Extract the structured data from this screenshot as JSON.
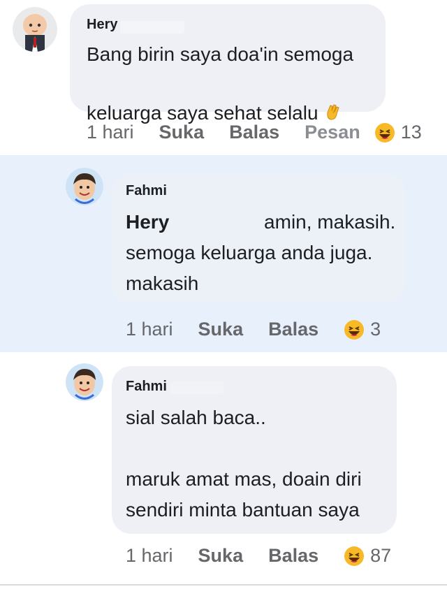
{
  "comments": [
    {
      "author": "Hery",
      "text": "Bang birin saya doa'in semoga\nkeluarga saya sehat selalu",
      "emoji_icon": "clapping-hands-icon",
      "time": "1 hari",
      "like": "Suka",
      "reply": "Balas",
      "message": "Pesan",
      "reaction_icon": "laughing-face-icon",
      "reaction_count": "13"
    },
    {
      "author": "Fahmi",
      "mention": "Hery",
      "text": "amin, makasih.\nsemoga keluarga anda juga.\nmakasih",
      "time": "1 hari",
      "like": "Suka",
      "reply": "Balas",
      "reaction_icon": "laughing-face-icon",
      "reaction_count": "3"
    },
    {
      "author": "Fahmi",
      "text": "sial salah baca..\n\nmaruk amat mas, doain diri\nsendiri minta bantuan saya",
      "time": "1 hari",
      "like": "Suka",
      "reply": "Balas",
      "reaction_icon": "laughing-face-icon",
      "reaction_count": "87"
    }
  ],
  "colors": {
    "highlight_row": "#e8f0fb",
    "bubble": "#eef0f5",
    "meta_text": "#65676b",
    "reaction_yellow": "#f7b928"
  }
}
